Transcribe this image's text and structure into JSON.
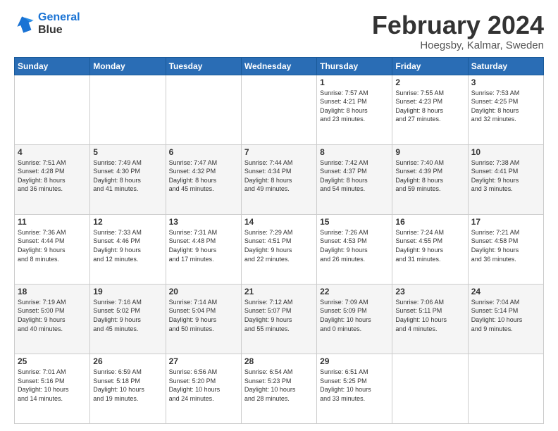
{
  "header": {
    "logo_line1": "General",
    "logo_line2": "Blue",
    "month": "February 2024",
    "location": "Hoegsby, Kalmar, Sweden"
  },
  "weekdays": [
    "Sunday",
    "Monday",
    "Tuesday",
    "Wednesday",
    "Thursday",
    "Friday",
    "Saturday"
  ],
  "weeks": [
    [
      {
        "day": "",
        "content": ""
      },
      {
        "day": "",
        "content": ""
      },
      {
        "day": "",
        "content": ""
      },
      {
        "day": "",
        "content": ""
      },
      {
        "day": "1",
        "content": "Sunrise: 7:57 AM\nSunset: 4:21 PM\nDaylight: 8 hours\nand 23 minutes."
      },
      {
        "day": "2",
        "content": "Sunrise: 7:55 AM\nSunset: 4:23 PM\nDaylight: 8 hours\nand 27 minutes."
      },
      {
        "day": "3",
        "content": "Sunrise: 7:53 AM\nSunset: 4:25 PM\nDaylight: 8 hours\nand 32 minutes."
      }
    ],
    [
      {
        "day": "4",
        "content": "Sunrise: 7:51 AM\nSunset: 4:28 PM\nDaylight: 8 hours\nand 36 minutes."
      },
      {
        "day": "5",
        "content": "Sunrise: 7:49 AM\nSunset: 4:30 PM\nDaylight: 8 hours\nand 41 minutes."
      },
      {
        "day": "6",
        "content": "Sunrise: 7:47 AM\nSunset: 4:32 PM\nDaylight: 8 hours\nand 45 minutes."
      },
      {
        "day": "7",
        "content": "Sunrise: 7:44 AM\nSunset: 4:34 PM\nDaylight: 8 hours\nand 49 minutes."
      },
      {
        "day": "8",
        "content": "Sunrise: 7:42 AM\nSunset: 4:37 PM\nDaylight: 8 hours\nand 54 minutes."
      },
      {
        "day": "9",
        "content": "Sunrise: 7:40 AM\nSunset: 4:39 PM\nDaylight: 8 hours\nand 59 minutes."
      },
      {
        "day": "10",
        "content": "Sunrise: 7:38 AM\nSunset: 4:41 PM\nDaylight: 9 hours\nand 3 minutes."
      }
    ],
    [
      {
        "day": "11",
        "content": "Sunrise: 7:36 AM\nSunset: 4:44 PM\nDaylight: 9 hours\nand 8 minutes."
      },
      {
        "day": "12",
        "content": "Sunrise: 7:33 AM\nSunset: 4:46 PM\nDaylight: 9 hours\nand 12 minutes."
      },
      {
        "day": "13",
        "content": "Sunrise: 7:31 AM\nSunset: 4:48 PM\nDaylight: 9 hours\nand 17 minutes."
      },
      {
        "day": "14",
        "content": "Sunrise: 7:29 AM\nSunset: 4:51 PM\nDaylight: 9 hours\nand 22 minutes."
      },
      {
        "day": "15",
        "content": "Sunrise: 7:26 AM\nSunset: 4:53 PM\nDaylight: 9 hours\nand 26 minutes."
      },
      {
        "day": "16",
        "content": "Sunrise: 7:24 AM\nSunset: 4:55 PM\nDaylight: 9 hours\nand 31 minutes."
      },
      {
        "day": "17",
        "content": "Sunrise: 7:21 AM\nSunset: 4:58 PM\nDaylight: 9 hours\nand 36 minutes."
      }
    ],
    [
      {
        "day": "18",
        "content": "Sunrise: 7:19 AM\nSunset: 5:00 PM\nDaylight: 9 hours\nand 40 minutes."
      },
      {
        "day": "19",
        "content": "Sunrise: 7:16 AM\nSunset: 5:02 PM\nDaylight: 9 hours\nand 45 minutes."
      },
      {
        "day": "20",
        "content": "Sunrise: 7:14 AM\nSunset: 5:04 PM\nDaylight: 9 hours\nand 50 minutes."
      },
      {
        "day": "21",
        "content": "Sunrise: 7:12 AM\nSunset: 5:07 PM\nDaylight: 9 hours\nand 55 minutes."
      },
      {
        "day": "22",
        "content": "Sunrise: 7:09 AM\nSunset: 5:09 PM\nDaylight: 10 hours\nand 0 minutes."
      },
      {
        "day": "23",
        "content": "Sunrise: 7:06 AM\nSunset: 5:11 PM\nDaylight: 10 hours\nand 4 minutes."
      },
      {
        "day": "24",
        "content": "Sunrise: 7:04 AM\nSunset: 5:14 PM\nDaylight: 10 hours\nand 9 minutes."
      }
    ],
    [
      {
        "day": "25",
        "content": "Sunrise: 7:01 AM\nSunset: 5:16 PM\nDaylight: 10 hours\nand 14 minutes."
      },
      {
        "day": "26",
        "content": "Sunrise: 6:59 AM\nSunset: 5:18 PM\nDaylight: 10 hours\nand 19 minutes."
      },
      {
        "day": "27",
        "content": "Sunrise: 6:56 AM\nSunset: 5:20 PM\nDaylight: 10 hours\nand 24 minutes."
      },
      {
        "day": "28",
        "content": "Sunrise: 6:54 AM\nSunset: 5:23 PM\nDaylight: 10 hours\nand 28 minutes."
      },
      {
        "day": "29",
        "content": "Sunrise: 6:51 AM\nSunset: 5:25 PM\nDaylight: 10 hours\nand 33 minutes."
      },
      {
        "day": "",
        "content": ""
      },
      {
        "day": "",
        "content": ""
      }
    ]
  ]
}
